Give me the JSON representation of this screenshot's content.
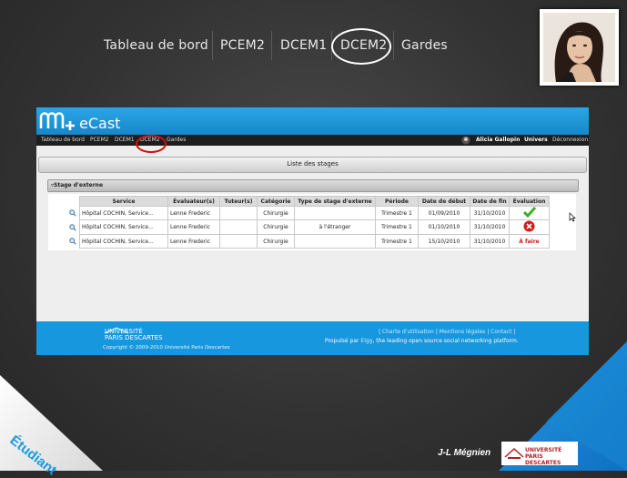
{
  "slide_nav": {
    "items": [
      "Tableau de bord",
      "PCEM2",
      "DCEM1",
      "DCEM2",
      "Gardes"
    ],
    "highlighted": "DCEM2"
  },
  "app": {
    "logo_text": "eCast",
    "menu": [
      "Tableau de bord",
      "PCEM2",
      "DCEM1",
      "DCEM2",
      "Gardes"
    ],
    "menu_highlighted": "DCEM2",
    "user_name": "Alicia Gallopin",
    "univers_label": "Univers",
    "logout_label": "Déconnexion",
    "panel_title": "Liste des stages",
    "section_title": "▿Stage d'externe",
    "table": {
      "headers": [
        "Service",
        "Évaluateur(s)",
        "Tuteur(s)",
        "Catégorie",
        "Type de stage d'externe",
        "Période",
        "Date de début",
        "Date de fin",
        "Évaluation"
      ],
      "rows": [
        {
          "service": "Hôpital COCHIN, Service...",
          "evaluateur": "Lenne Frederic",
          "tuteur": "",
          "categorie": "Chirurgie",
          "type": "",
          "periode": "Trimestre 1",
          "debut": "01/09/2010",
          "fin": "31/10/2010",
          "evaluation": "check-icon"
        },
        {
          "service": "Hôpital COCHIN, Service...",
          "evaluateur": "Lenne Frederic",
          "tuteur": "",
          "categorie": "Chirurgie",
          "type": "à l'étranger",
          "periode": "Trimestre 1",
          "debut": "01/10/2010",
          "fin": "31/10/2010",
          "evaluation": "cancel-icon"
        },
        {
          "service": "Hôpital COCHIN, Service...",
          "evaluateur": "Lenne Frederic",
          "tuteur": "",
          "categorie": "Chirurgie",
          "type": "",
          "periode": "Trimestre 1",
          "debut": "15/10/2010",
          "fin": "31/10/2010",
          "evaluation": "À faire"
        }
      ]
    },
    "footer": {
      "univ_line1": "UNIVERSITÉ",
      "univ_line2": "PARIS DESCARTES",
      "copyright": "Copyright © 2009-2010 Université Paris Descartes",
      "links": [
        "Charte d'utilisation",
        "Mentions légales",
        "Contact"
      ],
      "powered_prefix": "Propulsé par",
      "powered_link": "Elgg",
      "powered_suffix": ", the leading open source social networking platform."
    }
  },
  "slide": {
    "role_label": "Étudiant",
    "author": "J-L Mégnien",
    "corner_logo_line1": "UNIVERSITÉ",
    "corner_logo_line2": "PARIS DESCARTES"
  },
  "colors": {
    "accent_blue": "#1797dd",
    "highlight_red": "#d01010",
    "success_green": "#3bb02a",
    "todo_red": "#d21a1a"
  }
}
